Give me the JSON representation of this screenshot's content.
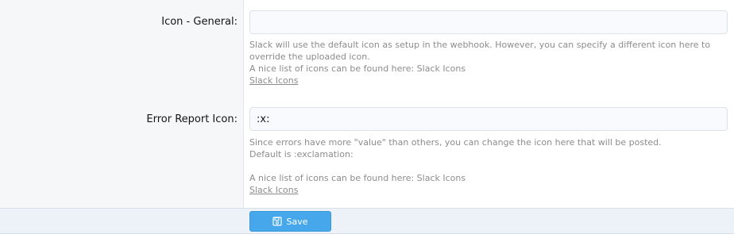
{
  "fields": {
    "icon_general": {
      "label": "Icon - General:",
      "value": "",
      "explain_1": "Slack will use the default icon as setup in the webhook. However, you can specify a different icon here to override the uploaded icon.",
      "explain_2": "A nice list of icons can be found here: Slack Icons",
      "link": "Slack Icons"
    },
    "error_report_icon": {
      "label": "Error Report Icon:",
      "value": ":x:",
      "explain_1": "Since errors have more \"value\" than others, you can change the icon here that will be posted.",
      "explain_2": "Default is :exclamation:",
      "explain_3": "A nice list of icons can be found here: Slack Icons",
      "link": "Slack Icons"
    }
  },
  "submit": {
    "save_label": "Save",
    "icon": "save-icon",
    "color": "#47a7eb"
  }
}
